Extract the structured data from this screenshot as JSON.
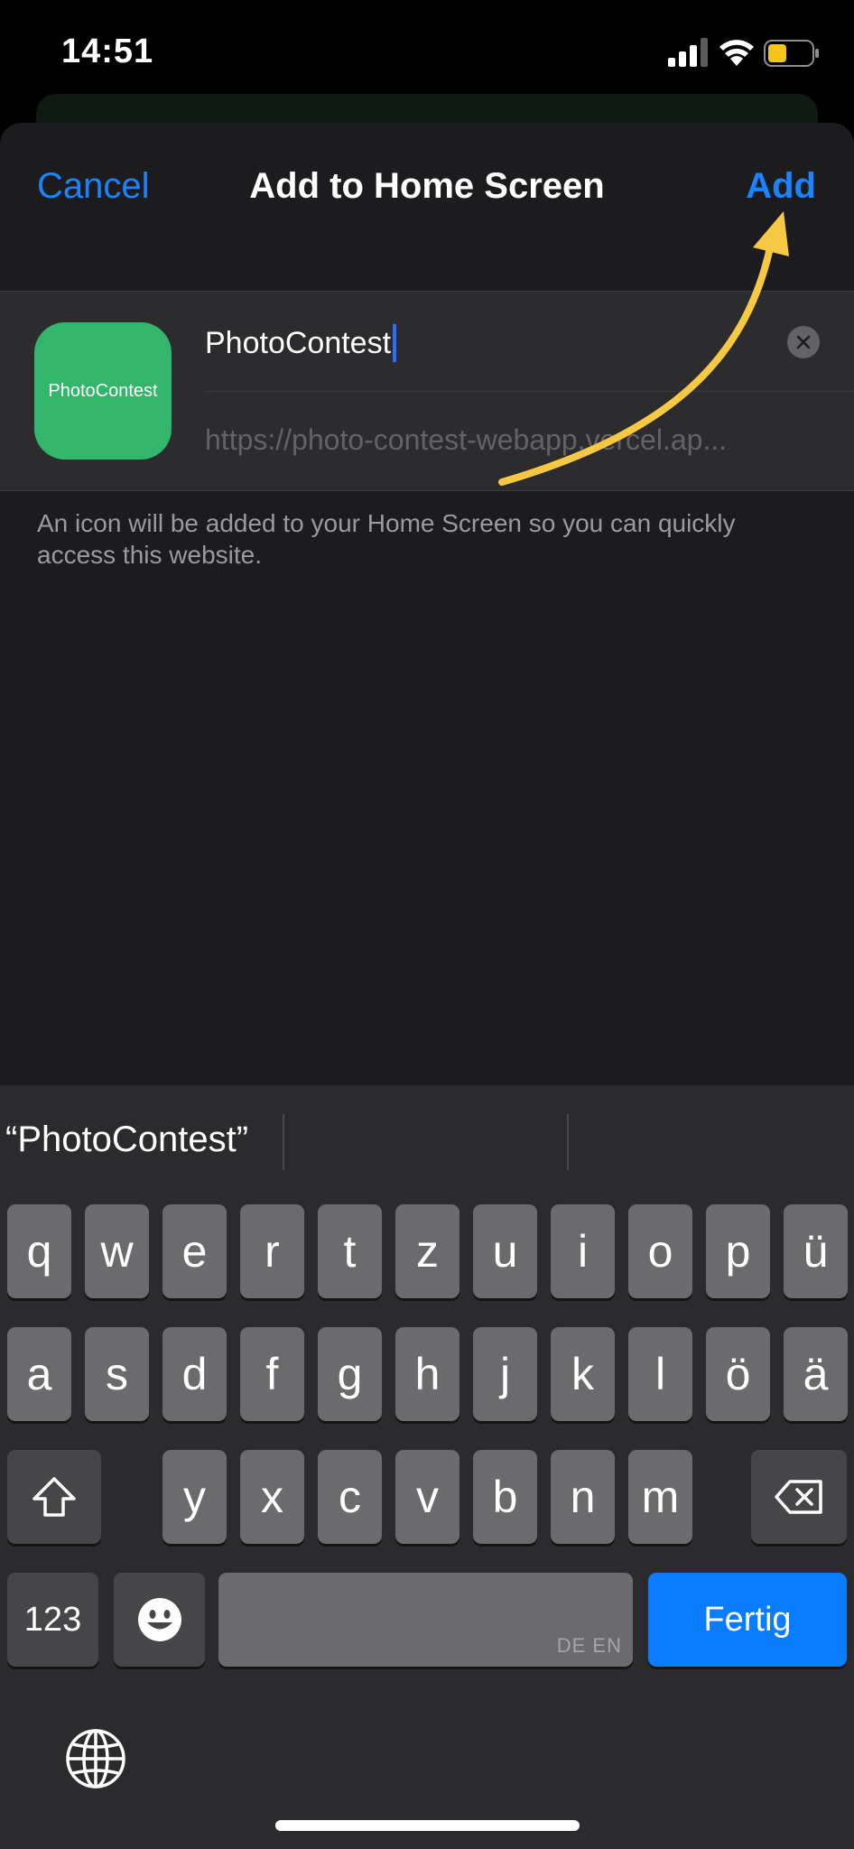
{
  "status": {
    "time": "14:51",
    "signal_icon": "cellular-signal-icon",
    "wifi_icon": "wifi-icon",
    "battery_icon": "battery-low-icon",
    "battery_color": "#f5c518"
  },
  "sheet": {
    "cancel_label": "Cancel",
    "title": "Add to Home Screen",
    "add_label": "Add",
    "accent_color": "#1a84ff",
    "app_icon_text": "PhotoContest",
    "app_icon_color": "#33b56c",
    "name_value": "PhotoContest",
    "url_value": "https://photo-contest-webapp.vercel.ap...",
    "description": "An icon will be added to your Home Screen so you can quickly access this website."
  },
  "keyboard": {
    "suggestion": "“PhotoContest”",
    "row1": [
      "q",
      "w",
      "e",
      "r",
      "t",
      "z",
      "u",
      "i",
      "o",
      "p",
      "ü"
    ],
    "row2": [
      "a",
      "s",
      "d",
      "f",
      "g",
      "h",
      "j",
      "k",
      "l",
      "ö",
      "ä"
    ],
    "row3": [
      "y",
      "x",
      "c",
      "v",
      "b",
      "n",
      "m"
    ],
    "numbers_label": "123",
    "space_languages": "DE EN",
    "done_label": "Fertig",
    "done_color": "#0a7cff"
  }
}
